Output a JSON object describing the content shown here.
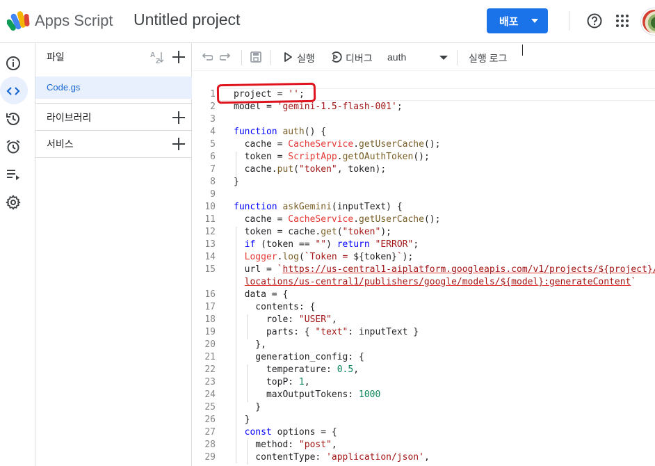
{
  "header": {
    "app_name": "Apps Script",
    "project_title": "Untitled project",
    "deploy_label": "배포",
    "accent_color": "#1a73e8"
  },
  "rail": {
    "icons": [
      "info-icon",
      "code-icon",
      "history-icon",
      "alarm-icon",
      "executions-icon",
      "settings-icon"
    ],
    "active": "code-icon"
  },
  "files_panel": {
    "files_label": "파일",
    "files": [
      "Code.gs"
    ],
    "libraries_label": "라이브러리",
    "services_label": "서비스"
  },
  "toolbar": {
    "run_label": "실행",
    "debug_label": "디버그",
    "function_selected": "auth",
    "log_label": "실행 로그"
  },
  "editor": {
    "lines": [
      {
        "n": "1",
        "html": "<span>project = </span><span class='str'>''</span><span>;</span>"
      },
      {
        "n": "2",
        "html": "<span>model = </span><span class='str'>'gemini-1.5-flash-001'</span><span>;</span>"
      },
      {
        "n": "3",
        "html": ""
      },
      {
        "n": "4",
        "html": "<span class='kw'>function</span> <span class='fn'>auth</span><span>() {</span>"
      },
      {
        "n": "5",
        "html": "  cache = <span class='svc'>CacheService</span>.<span class='fn'>getUserCache</span>();"
      },
      {
        "n": "6",
        "html": "  token = <span class='svc'>ScriptApp</span>.<span class='fn'>getOAuthToken</span>();"
      },
      {
        "n": "7",
        "html": "  cache.<span class='fn'>put</span>(<span class='str'>\"token\"</span>, token);"
      },
      {
        "n": "8",
        "html": "}"
      },
      {
        "n": "9",
        "html": ""
      },
      {
        "n": "10",
        "html": "<span class='kw'>function</span> <span class='fn'>askGemini</span>(inputText) {"
      },
      {
        "n": "11",
        "html": "  cache = <span class='svc'>CacheService</span>.<span class='fn'>getUserCache</span>();"
      },
      {
        "n": "12",
        "html": "  token = cache.<span class='fn'>get</span>(<span class='str'>\"token\"</span>);"
      },
      {
        "n": "13",
        "html": "  <span class='kw'>if</span> (token == <span class='str'>\"\"</span>) <span class='kw'>return</span> <span class='str'>\"ERROR\"</span>;"
      },
      {
        "n": "14",
        "html": "  <span class='svc'>Logger</span>.<span class='fn'>log</span>(<span class='str'>`Token = </span>${token}<span class='str'>`</span>);"
      },
      {
        "n": "15",
        "html": "  url = <span class='str'>`</span><span class='url'>https://us-central1-aiplatform.googleapis.com/v1/projects/${project}/</span>"
      },
      {
        "n": "",
        "html": "  <span class='url'>locations/us-central1/publishers/google/models/${model}:generateContent</span><span class='str'>`</span>"
      },
      {
        "n": "16",
        "html": "  data = {"
      },
      {
        "n": "17",
        "html": "    contents: {"
      },
      {
        "n": "18",
        "html": "      role: <span class='str'>\"USER\"</span>,"
      },
      {
        "n": "19",
        "html": "      parts: { <span class='str'>\"text\"</span>: inputText }"
      },
      {
        "n": "20",
        "html": "    },"
      },
      {
        "n": "21",
        "html": "    generation_config: {"
      },
      {
        "n": "22",
        "html": "      temperature: <span class='num'>0.5</span>,"
      },
      {
        "n": "23",
        "html": "      topP: <span class='num'>1</span>,"
      },
      {
        "n": "24",
        "html": "      maxOutputTokens: <span class='num'>1000</span>"
      },
      {
        "n": "25",
        "html": "    }"
      },
      {
        "n": "26",
        "html": "  }"
      },
      {
        "n": "27",
        "html": "  <span class='kw'>const</span> options = {"
      },
      {
        "n": "28",
        "html": "    method: <span class='str'>\"post\"</span>,"
      },
      {
        "n": "29",
        "html": "    contentType: <span class='str'>'application/json'</span>,"
      }
    ]
  }
}
